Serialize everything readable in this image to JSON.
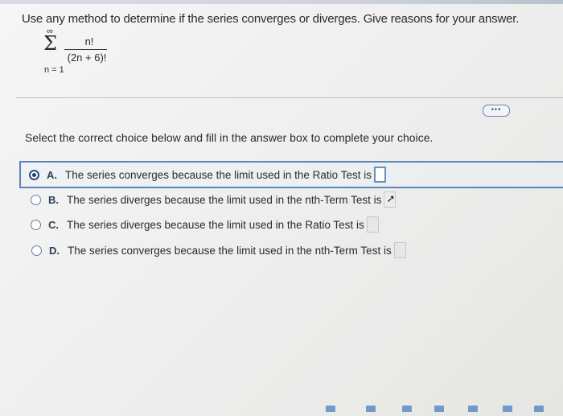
{
  "question": {
    "prompt": "Use any method to determine if the series converges or diverges. Give reasons for your answer.",
    "series": {
      "sigma": "Σ",
      "upper": "∞",
      "lower": "n = 1",
      "numerator": "n!",
      "denominator": "(2n + 6)!"
    }
  },
  "more_button": {
    "label": "•••"
  },
  "instruction": "Select the correct choice below and fill in the answer box to complete your choice.",
  "choices": [
    {
      "letter": "A.",
      "text": "The series converges because the limit used in the Ratio Test is",
      "selected": true
    },
    {
      "letter": "B.",
      "text": "The series diverges because the limit used in the nth-Term Test is",
      "selected": false
    },
    {
      "letter": "C.",
      "text": "The series diverges because the limit used in the Ratio Test is",
      "selected": false
    },
    {
      "letter": "D.",
      "text": "The series converges because the limit used in the nth-Term Test is",
      "selected": false
    }
  ],
  "icons": {
    "cursor": "pointer-cursor-icon",
    "toolbar": [
      "fraction-tool-icon",
      "mixed-number-tool-icon",
      "exponent-tool-icon",
      "absolute-value-tool-icon",
      "root-tool-icon",
      "nth-root-tool-icon",
      "parentheses-tool-icon"
    ]
  },
  "colors": {
    "selection_border": "#5b84b8",
    "radio_selected": "#1e3f6a",
    "toolbar_icon": "#4a7fbf"
  }
}
